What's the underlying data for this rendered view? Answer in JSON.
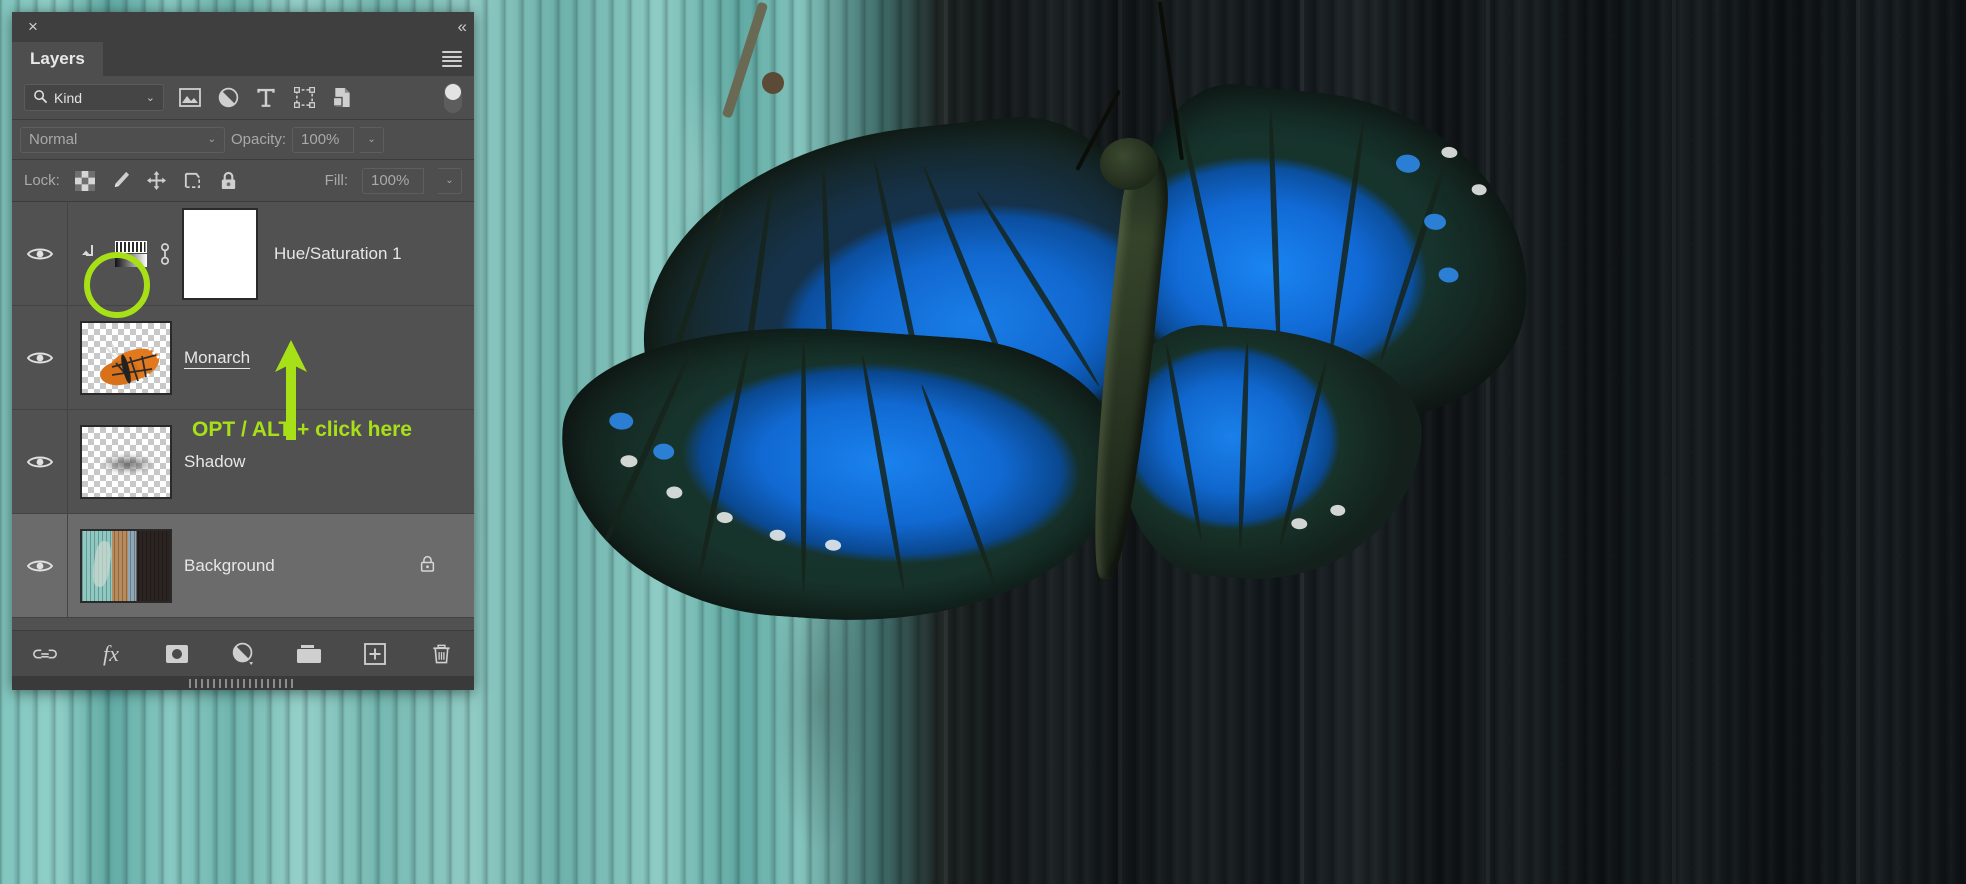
{
  "photo": {
    "description": "blue-tinted butterfly on teal and dark wood background"
  },
  "panel": {
    "close_label": "×",
    "collapse_label": "«",
    "tab_label": "Layers",
    "menu_icon": "hamburger-menu-icon"
  },
  "filter": {
    "kind_label": "Kind",
    "search_icon": "search-icon",
    "chevron": "⌄",
    "icons": [
      {
        "name": "filter-pixel-layers-icon",
        "label": "Pixel"
      },
      {
        "name": "filter-adjustment-layers-icon",
        "label": "Adjustment"
      },
      {
        "name": "filter-type-layers-icon",
        "label": "Type"
      },
      {
        "name": "filter-shape-layers-icon",
        "label": "Shape"
      },
      {
        "name": "filter-smart-object-icon",
        "label": "Smart Object"
      }
    ],
    "toggle_name": "filter-enable-toggle"
  },
  "blend": {
    "mode": "Normal",
    "chevron": "⌄",
    "opacity_label": "Opacity:",
    "opacity_value": "100%"
  },
  "lock": {
    "label": "Lock:",
    "icons": [
      {
        "name": "lock-transparent-pixels-icon"
      },
      {
        "name": "lock-image-pixels-icon"
      },
      {
        "name": "lock-position-icon"
      },
      {
        "name": "lock-artboard-nesting-icon"
      },
      {
        "name": "lock-all-icon"
      }
    ],
    "fill_label": "Fill:",
    "fill_value": "100%"
  },
  "layers": [
    {
      "name": "Hue/Saturation 1",
      "type": "adjustment",
      "visible": true,
      "selected": false,
      "clipped": true,
      "has_mask": true,
      "linked": true,
      "locked": false,
      "renaming": false
    },
    {
      "name": "Monarch",
      "type": "pixel",
      "visible": true,
      "selected": false,
      "clipped": false,
      "has_mask": false,
      "linked": false,
      "locked": false,
      "renaming": true
    },
    {
      "name": "Shadow",
      "type": "pixel",
      "visible": true,
      "selected": false,
      "clipped": false,
      "has_mask": false,
      "linked": false,
      "locked": false,
      "renaming": false
    },
    {
      "name": "Background",
      "type": "pixel",
      "visible": true,
      "selected": true,
      "clipped": false,
      "has_mask": false,
      "linked": false,
      "locked": true,
      "renaming": false
    }
  ],
  "footer": {
    "buttons": [
      {
        "name": "link-layers-button",
        "label": "Link layers"
      },
      {
        "name": "layer-style-fx-button",
        "label": "fx"
      },
      {
        "name": "add-layer-mask-button",
        "label": "Add layer mask"
      },
      {
        "name": "new-adjustment-layer-button",
        "label": "New adjustment layer"
      },
      {
        "name": "new-group-button",
        "label": "New group"
      },
      {
        "name": "new-layer-button",
        "label": "New layer"
      },
      {
        "name": "delete-layer-button",
        "label": "Delete layer"
      }
    ]
  },
  "annotations": {
    "circle_target": "clipping-mask-arrow",
    "arrow_target": "monarch-layer-boundary",
    "instruction_text": "OPT / ALT + click here",
    "accent_color": "#a8e018"
  }
}
